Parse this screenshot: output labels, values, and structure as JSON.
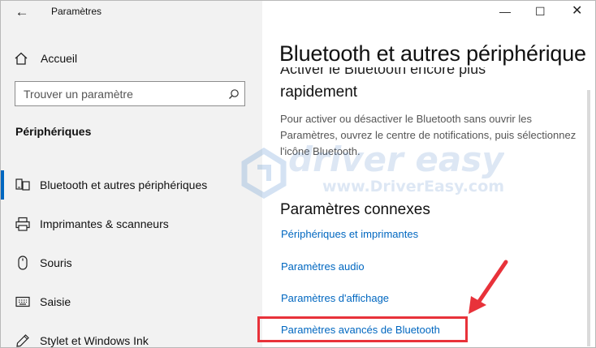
{
  "window": {
    "title": "Paramètres",
    "back_icon": "back-arrow-icon",
    "controls": [
      "minimize-icon",
      "maximize-icon",
      "close-icon"
    ]
  },
  "sidebar": {
    "home_label": "Accueil",
    "search_placeholder": "Trouver un paramètre",
    "section_title": "Périphériques",
    "items": [
      {
        "label": "Bluetooth et autres périphériques",
        "icon": "bluetooth-device-icon",
        "selected": true
      },
      {
        "label": "Imprimantes & scanneurs",
        "icon": "printer-icon",
        "selected": false
      },
      {
        "label": "Souris",
        "icon": "mouse-icon",
        "selected": false
      },
      {
        "label": "Saisie",
        "icon": "keyboard-icon",
        "selected": false
      },
      {
        "label": "Stylet et Windows Ink",
        "icon": "pen-icon",
        "selected": false
      }
    ]
  },
  "main": {
    "page_title": "Bluetooth et autres périphérique",
    "partial_heading_cut": "Activer le Bluetooth encore plus",
    "heading_rest": "rapidement",
    "description": "Pour activer ou désactiver le Bluetooth sans ouvrir les Paramètres, ouvrez le centre de notifications, puis sélectionnez l'icône Bluetooth.",
    "related_title": "Paramètres connexes",
    "links": [
      "Périphériques et imprimantes",
      "Paramètres audio",
      "Paramètres d'affichage",
      "Paramètres avancés de Bluetooth"
    ]
  },
  "watermark": {
    "brand": "driver easy",
    "url": "www.DriverEasy.com"
  },
  "colors": {
    "accent": "#0067c0",
    "highlight": "#e8323a",
    "sidebar_bg": "#f2f2f2"
  }
}
